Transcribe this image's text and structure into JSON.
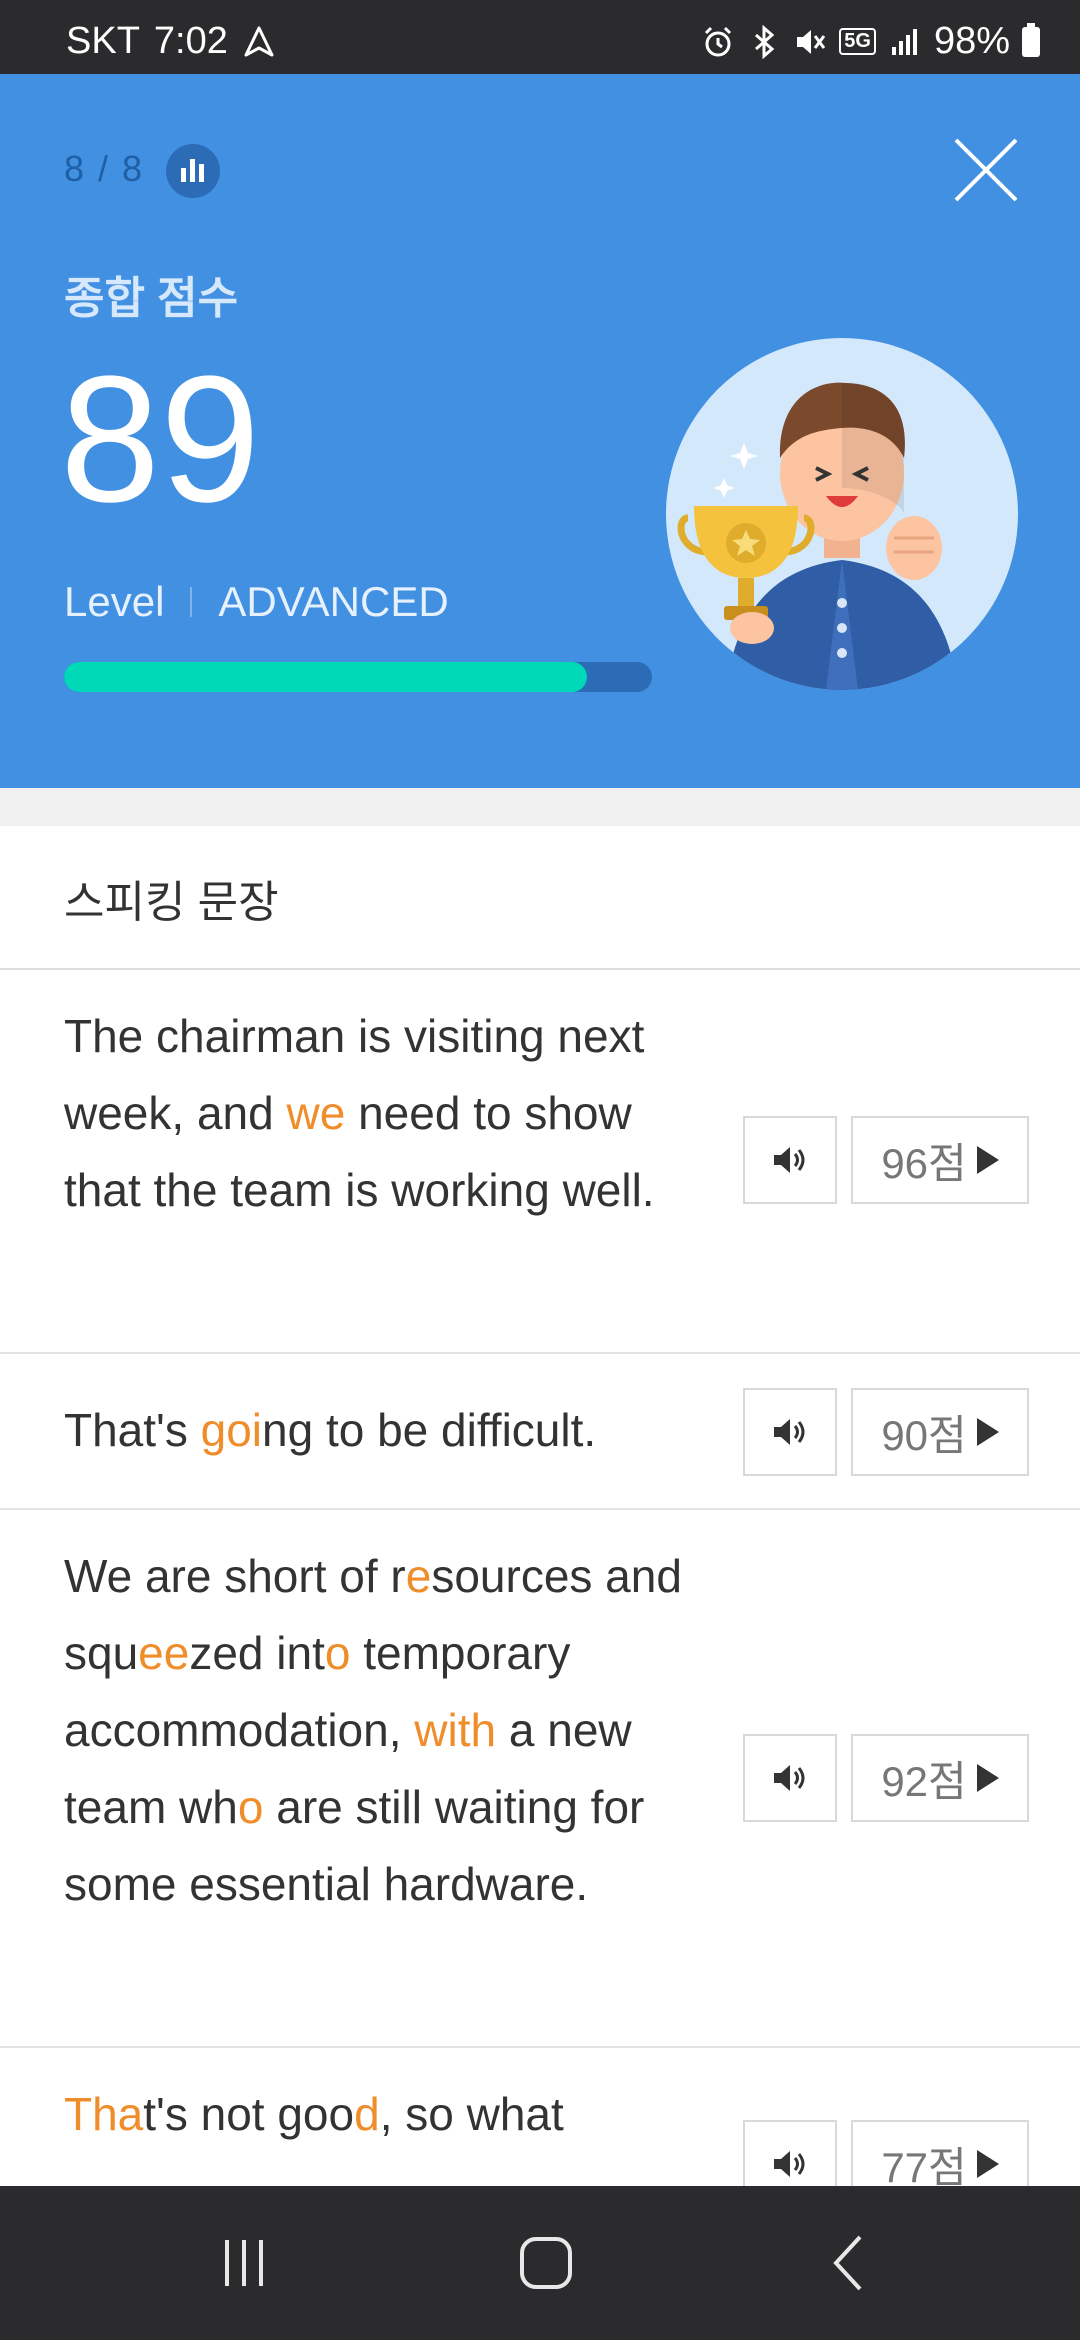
{
  "status": {
    "carrier": "SKT",
    "time": "7:02",
    "network": "5G",
    "battery": "98%"
  },
  "header": {
    "progress": "8 / 8",
    "score_label": "종합 점수",
    "score": "89",
    "level_label": "Level",
    "level_value": "ADVANCED",
    "level_fill_percent": 89,
    "colors": {
      "background": "#4190e2",
      "bar_fill": "#00d9b8",
      "bar_track": "#2c6bb6"
    }
  },
  "section": {
    "title": "스피킹 문장"
  },
  "sentences": [
    {
      "segments": [
        {
          "t": "The chairman is visiting next week, and ",
          "h": false
        },
        {
          "t": "we",
          "h": true
        },
        {
          "t": " need to show that the team is working well.",
          "h": false
        }
      ],
      "score": "96점"
    },
    {
      "segments": [
        {
          "t": "That's ",
          "h": false
        },
        {
          "t": "goi",
          "h": true
        },
        {
          "t": "ng to be difficult.",
          "h": false
        }
      ],
      "score": "90점"
    },
    {
      "segments": [
        {
          "t": "We are short of r",
          "h": false
        },
        {
          "t": "e",
          "h": true
        },
        {
          "t": "sources and squ",
          "h": false
        },
        {
          "t": "ee",
          "h": true
        },
        {
          "t": "zed int",
          "h": false
        },
        {
          "t": "o",
          "h": true
        },
        {
          "t": " temporary accommodation, ",
          "h": false
        },
        {
          "t": "with",
          "h": true
        },
        {
          "t": " a new team wh",
          "h": false
        },
        {
          "t": "o",
          "h": true
        },
        {
          "t": " are still waiting for some essential hardware.",
          "h": false
        }
      ],
      "score": "92점"
    },
    {
      "segments": [
        {
          "t": "Tha",
          "h": true
        },
        {
          "t": "t's not goo",
          "h": false
        },
        {
          "t": "d",
          "h": true
        },
        {
          "t": ", so what",
          "h": false
        }
      ],
      "score": "77점"
    }
  ],
  "icons": {
    "stats": "bar-chart-icon",
    "close": "close-icon",
    "speaker": "speaker-icon",
    "play": "play-icon"
  },
  "highlight_color": "#f08d2b"
}
